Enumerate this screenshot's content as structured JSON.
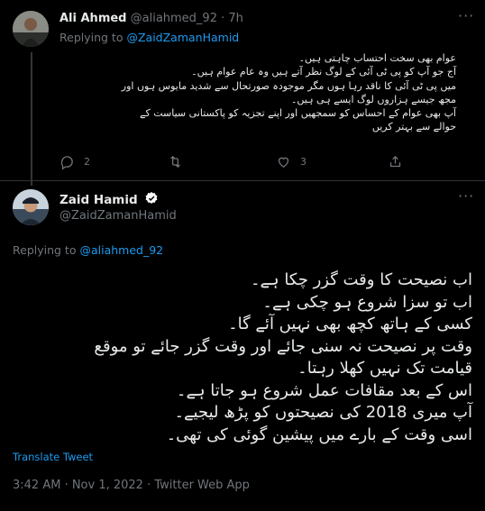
{
  "reply_tweet": {
    "author_name": "Ali Ahmed",
    "author_handle": "@aliahmed_92",
    "time": "· 7h",
    "replying_to_prefix": "Replying to",
    "replying_to_handle": "@ZaidZamanHamid",
    "text_lines": [
      "عوام بھی سخت احتساب چاہتی ہیں۔",
      "آج جو آپ کو پی ٹی آئی کے لوگ نظر آتے ہیں وہ عام عوام ہیں۔",
      "میں پی ٹی آئی کا ناقد رہا ہوں مگر موجودہ صورتحال سے شدید مایوس ہوں اور",
      "مجھ جیسے ہزاروں لوگ ایسے ہی ہیں۔",
      "آپ بھی عوام کے احساس کو سمجھیں اور اپنے تجزیہ کو پاکستانی سیاست کے",
      "حوالے سے بہتر کریں"
    ],
    "reply_count": "2",
    "retweet_count": "",
    "like_count": "3"
  },
  "main_tweet": {
    "author_name": "Zaid Hamid",
    "author_handle": "@ZaidZamanHamid",
    "replying_to_prefix": "Replying to",
    "replying_to_handle": "@aliahmed_92",
    "text_lines": [
      "اب نصیحت کا وقت گزر چکا ہے۔",
      "اب تو سزا شروع ہو چکی ہے۔",
      "کسی کے ہاتھ کچھ بھی نہیں آئے گا۔",
      "وقت پر نصیحت نہ سنی جائے اور وقت گزر جائے تو موقع",
      "قیامت تک نہیں کھلا رہتا۔",
      "اس کے بعد مقافات عمل شروع ہو جاتا ہے۔",
      "آپ میری 2018 کی نصیحتوں کو پڑھ لیجیے۔",
      "اسی وقت کے بارے میں پیشین گوئی کی تھی۔"
    ],
    "translate_label": "Translate Tweet",
    "timestamp": "3:42 AM · Nov 1, 2022 · Twitter Web App"
  },
  "colors": {
    "accent": "#1d9bf0",
    "muted": "#71767b",
    "background": "#000000",
    "text": "#e7e9ea"
  },
  "icons": [
    "reply-icon",
    "retweet-icon",
    "like-icon",
    "share-icon",
    "more-icon",
    "verified-icon"
  ]
}
